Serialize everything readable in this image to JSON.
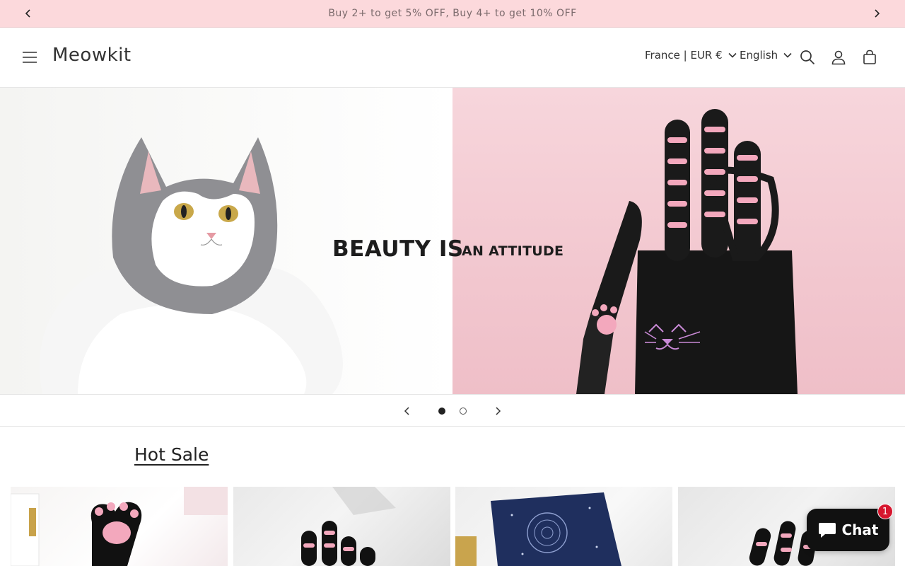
{
  "announcement": {
    "text": "Buy 2+ to get 5% OFF, Buy 4+ to get 10% OFF"
  },
  "header": {
    "logo": "Meowkit",
    "country_selector": "France | EUR €",
    "language_selector": "English"
  },
  "hero": {
    "heading": "BEAUTY IS",
    "subheading": "AN ATTITUDE",
    "slides_total": 2,
    "active_slide": 1
  },
  "hot_sale": {
    "title": "Hot Sale",
    "products": [
      {
        "image": "paw-mirror"
      },
      {
        "image": "paw-knife-set"
      },
      {
        "image": "star-gift-box"
      },
      {
        "image": "paw-scissors"
      }
    ]
  },
  "chat": {
    "label": "Chat",
    "badge": "1"
  },
  "colors": {
    "announcement_bg": "#fcd9dc",
    "hero_right_bg": "#f2c7cf",
    "chat_bg": "#111111",
    "badge": "#d6162e"
  }
}
